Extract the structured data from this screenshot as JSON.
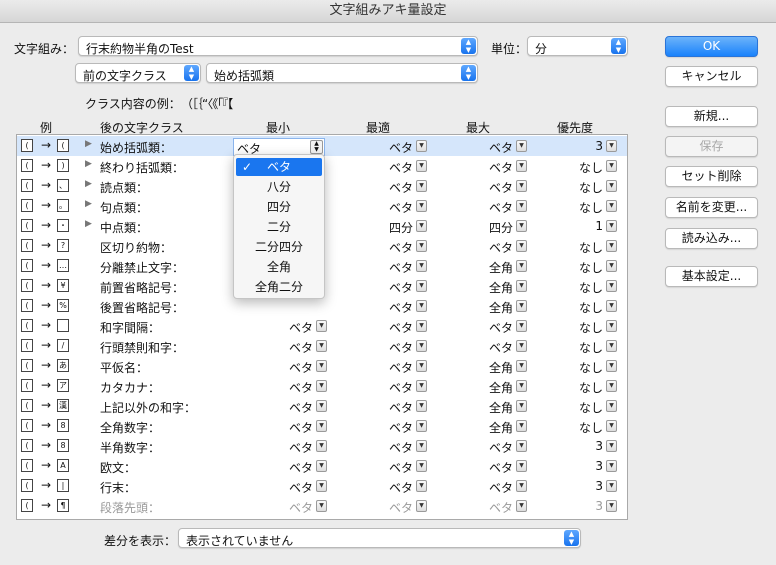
{
  "window": {
    "title": "文字組みアキ量設定"
  },
  "top": {
    "mojigumi_label": "文字組み：",
    "mojigumi_value": "行末約物半角のTest",
    "unit_label": "単位：",
    "unit_value": "分",
    "prev_class_value": "前の文字クラス",
    "class_value": "始め括弧類",
    "example_label": "クラス内容の例：",
    "example_chars": "（［｛“〈《「『【"
  },
  "buttons": {
    "ok": "OK",
    "cancel": "キャンセル",
    "new": "新規...",
    "save": "保存",
    "set_delete": "セット削除",
    "rename": "名前を変更...",
    "load": "読み込み...",
    "basic": "基本設定..."
  },
  "columns": {
    "example": "例",
    "after_class": "後の文字クラス",
    "min": "最小",
    "opt": "最適",
    "max": "最大",
    "priority": "優先度"
  },
  "rows": [
    {
      "glyph": "(",
      "target": "(",
      "name": "始め括弧類：",
      "min": "ベタ",
      "opt": "ベタ",
      "max": "ベタ",
      "pri": "3",
      "arrow": "▶"
    },
    {
      "glyph": "(",
      "target": ")",
      "name": "終わり括弧類：",
      "min": "",
      "opt": "ベタ",
      "max": "ベタ",
      "pri": "なし",
      "arrow": "▶"
    },
    {
      "glyph": "(",
      "target": "、",
      "name": "読点類：",
      "min": "",
      "opt": "ベタ",
      "max": "ベタ",
      "pri": "なし",
      "arrow": "▶"
    },
    {
      "glyph": "(",
      "target": "。",
      "name": "句点類：",
      "min": "",
      "opt": "ベタ",
      "max": "ベタ",
      "pri": "なし",
      "arrow": "▶"
    },
    {
      "glyph": "(",
      "target": "・",
      "name": "中点類：",
      "min": "",
      "opt": "四分",
      "max": "四分",
      "pri": "1",
      "arrow": "▶"
    },
    {
      "glyph": "(",
      "target": "?",
      "name": "区切り約物：",
      "min": "",
      "opt": "ベタ",
      "max": "ベタ",
      "pri": "なし",
      "arrow": ""
    },
    {
      "glyph": "(",
      "target": "…",
      "name": "分離禁止文字：",
      "min": "",
      "opt": "ベタ",
      "max": "全角",
      "pri": "なし",
      "arrow": ""
    },
    {
      "glyph": "(",
      "target": "¥",
      "name": "前置省略記号：",
      "min": "",
      "opt": "ベタ",
      "max": "全角",
      "pri": "なし",
      "arrow": ""
    },
    {
      "glyph": "(",
      "target": "%",
      "name": "後置省略記号：",
      "min": "",
      "opt": "ベタ",
      "max": "全角",
      "pri": "なし",
      "arrow": ""
    },
    {
      "glyph": "(",
      "target": "",
      "name": "和字間隔：",
      "min": "ベタ",
      "opt": "ベタ",
      "max": "ベタ",
      "pri": "なし",
      "arrow": ""
    },
    {
      "glyph": "(",
      "target": "/",
      "name": "行頭禁則和字：",
      "min": "ベタ",
      "opt": "ベタ",
      "max": "ベタ",
      "pri": "なし",
      "arrow": ""
    },
    {
      "glyph": "(",
      "target": "あ",
      "name": "平仮名：",
      "min": "ベタ",
      "opt": "ベタ",
      "max": "全角",
      "pri": "なし",
      "arrow": ""
    },
    {
      "glyph": "(",
      "target": "ア",
      "name": "カタカナ：",
      "min": "ベタ",
      "opt": "ベタ",
      "max": "全角",
      "pri": "なし",
      "arrow": ""
    },
    {
      "glyph": "(",
      "target": "漢",
      "name": "上記以外の和字：",
      "min": "ベタ",
      "opt": "ベタ",
      "max": "全角",
      "pri": "なし",
      "arrow": ""
    },
    {
      "glyph": "(",
      "target": "8",
      "name": "全角数字：",
      "min": "ベタ",
      "opt": "ベタ",
      "max": "全角",
      "pri": "なし",
      "arrow": ""
    },
    {
      "glyph": "(",
      "target": "8",
      "name": "半角数字：",
      "min": "ベタ",
      "opt": "ベタ",
      "max": "ベタ",
      "pri": "3",
      "arrow": ""
    },
    {
      "glyph": "(",
      "target": "A",
      "name": "欧文：",
      "min": "ベタ",
      "opt": "ベタ",
      "max": "ベタ",
      "pri": "3",
      "arrow": ""
    },
    {
      "glyph": "(",
      "target": "|",
      "name": "行末：",
      "min": "ベタ",
      "opt": "ベタ",
      "max": "ベタ",
      "pri": "3",
      "arrow": ""
    },
    {
      "glyph": "(",
      "target": "¶",
      "name": "段落先頭：",
      "min": "ベタ",
      "opt": "ベタ",
      "max": "ベタ",
      "pri": "3",
      "arrow": "",
      "dim": true
    }
  ],
  "editing_min_value": "ベタ",
  "dropdown": {
    "checked_index": 0,
    "items": [
      "ベタ",
      "八分",
      "四分",
      "二分",
      "二分四分",
      "全角",
      "全角二分"
    ],
    "check": "✓"
  },
  "bottom": {
    "diff_label": "差分を表示：",
    "diff_value": "表示されていません"
  }
}
